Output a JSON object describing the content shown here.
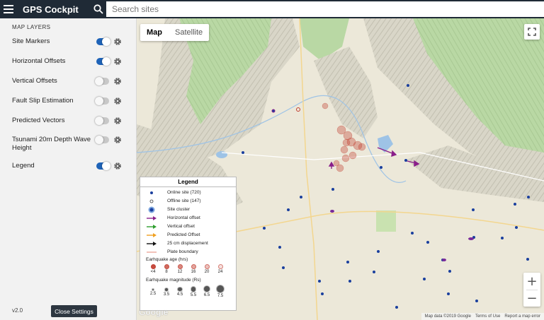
{
  "header": {
    "title": "GPS Cockpit",
    "search_placeholder": "Search sites"
  },
  "sidebar": {
    "section_title": "MAP LAYERS",
    "layers": [
      {
        "label": "Site Markers",
        "on": true
      },
      {
        "label": "Horizontal Offsets",
        "on": true
      },
      {
        "label": "Vertical Offsets",
        "on": false
      },
      {
        "label": "Fault Slip Estimation",
        "on": false
      },
      {
        "label": "Predicted Vectors",
        "on": false
      },
      {
        "label": "Tsunami 20m Depth Wave Height",
        "on": false
      },
      {
        "label": "Legend",
        "on": true
      }
    ],
    "version": "v2.0",
    "close_label": "Close Settings"
  },
  "map": {
    "types": [
      "Map",
      "Satellite"
    ],
    "active_type": "Map",
    "logo": "Google",
    "attribution": [
      "Map data ©2019 Google",
      "Terms of Use",
      "Report a map error"
    ],
    "zoom_in": "+",
    "zoom_out": "−"
  },
  "legend": {
    "title": "Legend",
    "items": [
      {
        "label": "Online site (720)",
        "symbol": "online-dot"
      },
      {
        "label": "Offline site (147)",
        "symbol": "offline-dot"
      },
      {
        "label": "Site cluster",
        "symbol": "cluster"
      },
      {
        "label": "Horizontal offset",
        "symbol": "arrow",
        "color": "#8a1f8a"
      },
      {
        "label": "Vertical offset",
        "symbol": "arrow",
        "color": "#2e9e2e"
      },
      {
        "label": "Predicted Offset",
        "symbol": "arrow",
        "color": "#f0a020"
      },
      {
        "label": "25 cm displacement",
        "symbol": "arrow",
        "color": "#111111"
      },
      {
        "label": "Plate boundary",
        "symbol": "line",
        "color": "#e89a8a"
      }
    ],
    "age_title": "Earhquake age (hrs)",
    "ages": [
      "<4",
      "8",
      "12",
      "16",
      "20",
      "24"
    ],
    "magnitude_title": "Earhquake magnitude (Rs)",
    "magnitudes": [
      "2.5",
      "3.5",
      "4.5",
      "5.5",
      "6.5",
      "7.5"
    ]
  },
  "colors": {
    "topbar": "#1f2a36",
    "toggle_on": "#1e63b8",
    "site_dot": "#1a3f9e",
    "quake": "#c0392b"
  }
}
